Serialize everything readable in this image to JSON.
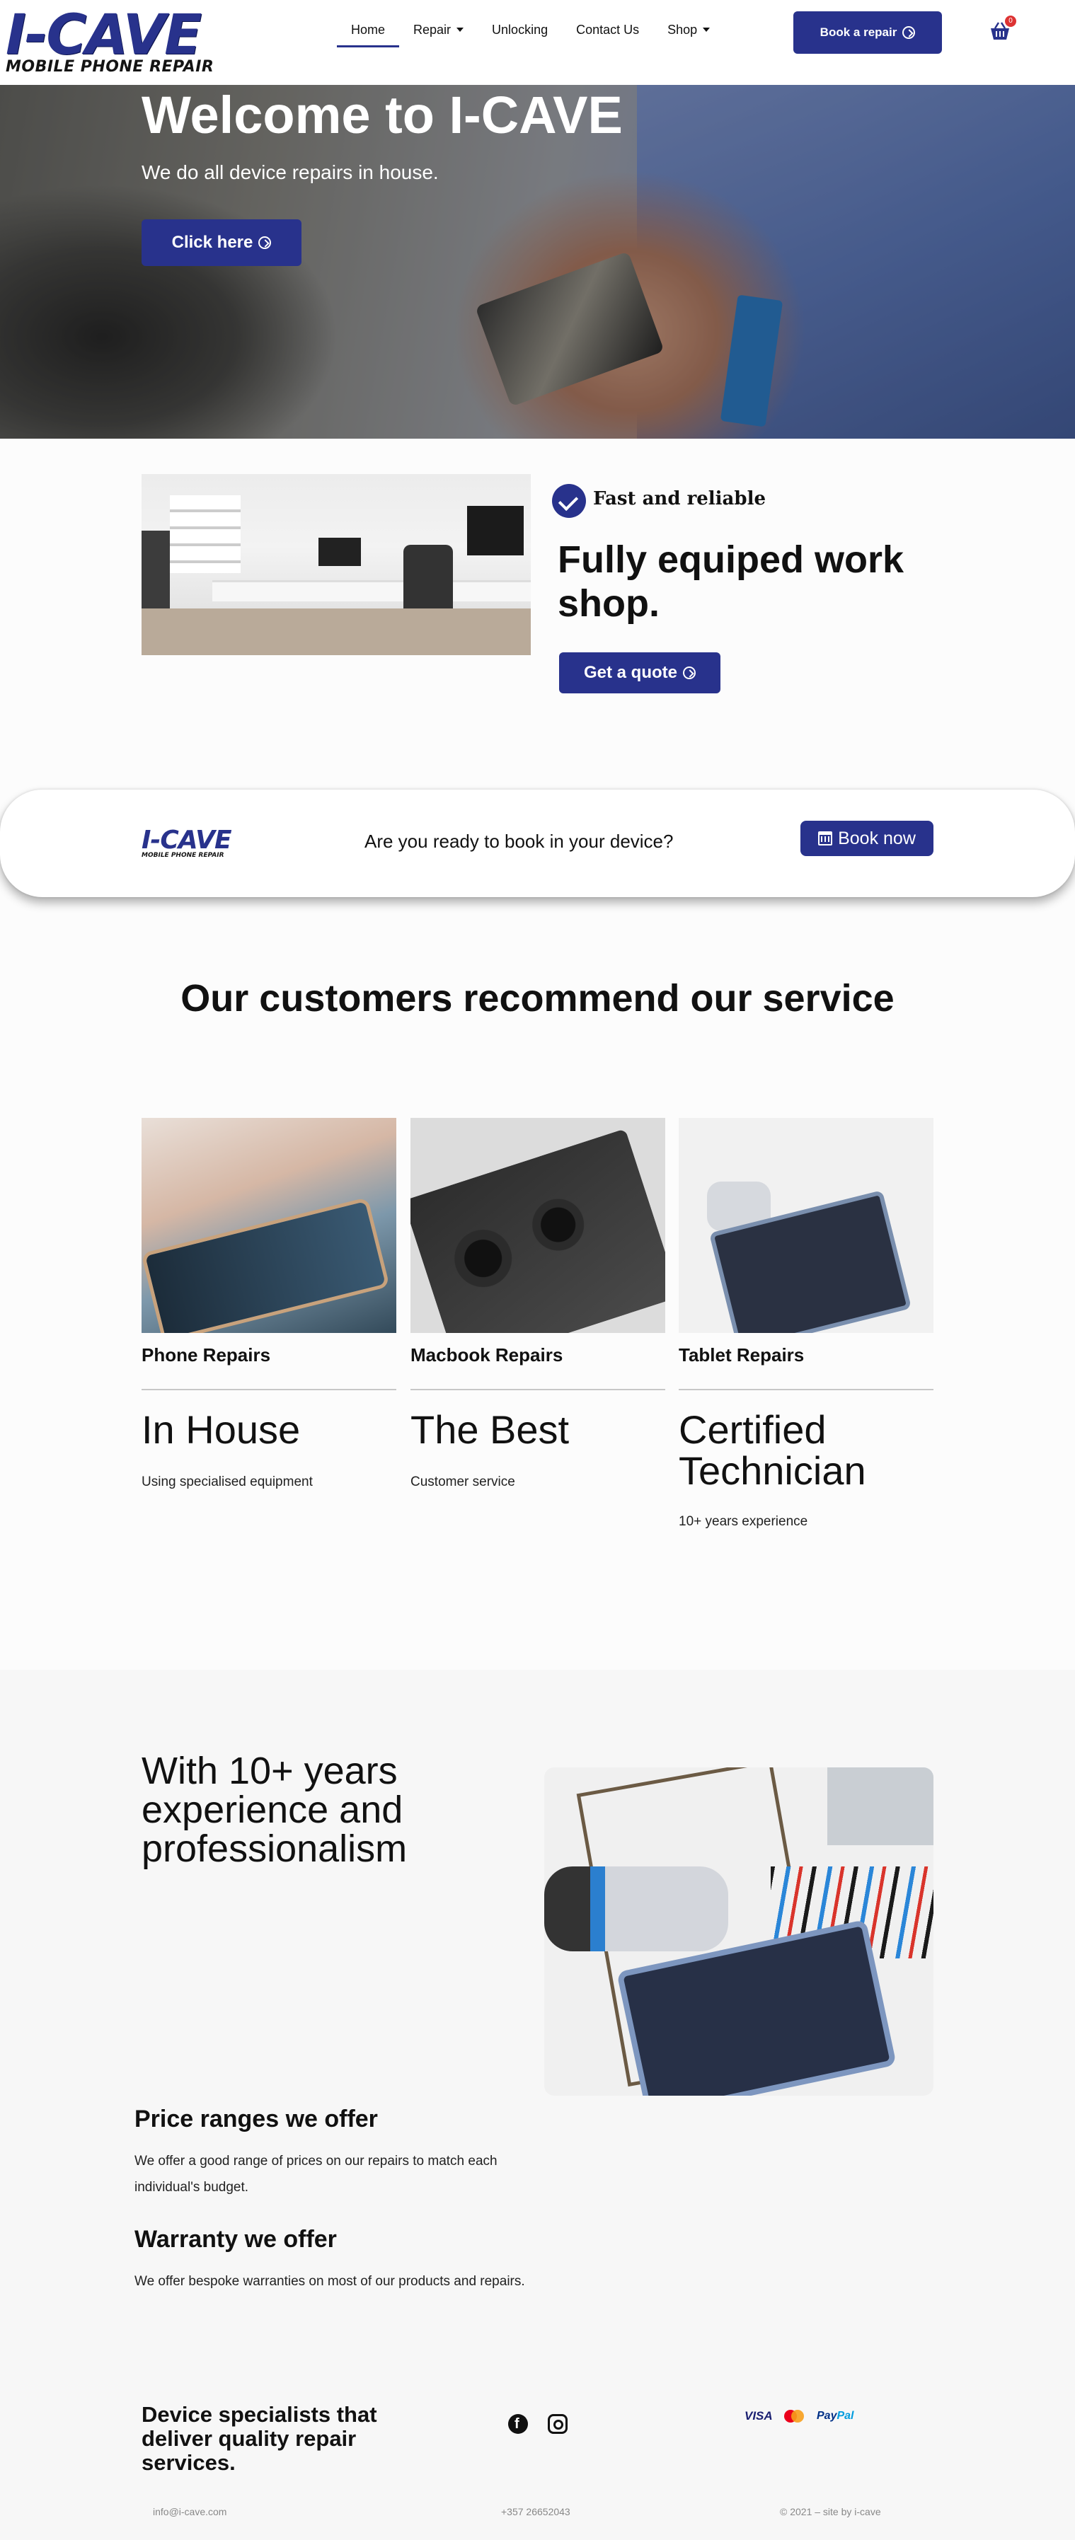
{
  "header": {
    "logo_main": "I-CAVE",
    "logo_sub": "MOBILE PHONE REPAIR",
    "nav": [
      {
        "label": "Home",
        "active": true
      },
      {
        "label": "Repair",
        "dropdown": true
      },
      {
        "label": "Unlocking"
      },
      {
        "label": "Contact Us"
      },
      {
        "label": "Shop",
        "dropdown": true
      }
    ],
    "book_button": "Book a repair",
    "cart_count": "0"
  },
  "hero": {
    "title": "Welcome to I-CAVE",
    "subtitle": "We do all device repairs in house.",
    "button": "Click here"
  },
  "workshop": {
    "badge_label": "Fast and reliable",
    "title": "Fully equiped work shop.",
    "button": "Get a quote"
  },
  "book_bar": {
    "logo_main": "I-CAVE",
    "logo_sub": "MOBILE PHONE REPAIR",
    "text": "Are you ready to book in your device?",
    "button": "Book now"
  },
  "recommend": {
    "title": "Our customers recommend our service",
    "services": [
      {
        "name": "Phone Repairs",
        "headline": "In House",
        "caption": "Using specialised equipment"
      },
      {
        "name": "Macbook Repairs",
        "headline": "The Best",
        "caption": "Customer service"
      },
      {
        "name": "Tablet Repairs",
        "headline": "Certified Technician",
        "caption": "10+ years experience"
      }
    ]
  },
  "experience": {
    "title": "With 10+ years experience and professionalism",
    "price_title": "Price ranges we offer",
    "price_text": "We offer a good range of prices on our repairs to match each individual's budget.",
    "warranty_title": "Warranty we offer",
    "warranty_text": "We offer bespoke warranties on most of our products and repairs."
  },
  "footer": {
    "title": "Device specialists that deliver quality repair services.",
    "payments": {
      "visa": "VISA",
      "paypal_a": "Pay",
      "paypal_b": "Pal"
    },
    "email": "info@i-cave.com",
    "phone": "+357 26652043",
    "copyright": "© 2021 – site by i-cave"
  },
  "colors": {
    "accent": "#28328c"
  },
  "icons": [
    "circle-arrow-icon",
    "caret-down-icon",
    "basket-icon",
    "check-badge-icon",
    "calendar-icon",
    "facebook-icon",
    "instagram-icon",
    "mastercard-icon"
  ]
}
